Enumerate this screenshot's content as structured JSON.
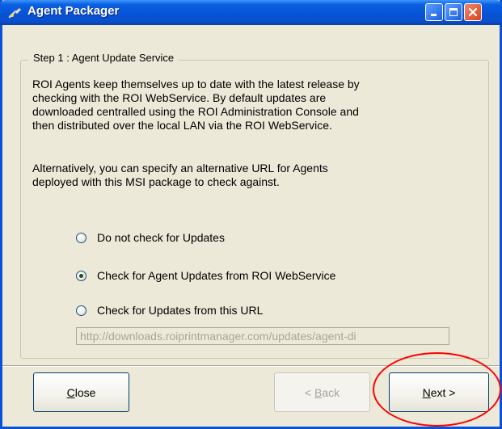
{
  "window": {
    "title": "Agent Packager",
    "controls": {
      "minimize": "minimize",
      "maximize": "maximize",
      "close": "close"
    }
  },
  "step": {
    "label": "Step 1 : Agent Update Service",
    "description1": "ROI Agents keep themselves up to date with the latest release by\nchecking with the ROI WebService. By default updates are\ndownloaded centralled using the ROI Administration Console and\nthen distributed over the local LAN via the ROI WebService.",
    "description2": "Alternatively, you can specify an alternative URL for Agents\ndeployed with this MSI package to check against."
  },
  "options": [
    {
      "label": "Do not check for Updates",
      "checked": false
    },
    {
      "label": "Check for Agent Updates from ROI WebService",
      "checked": true
    },
    {
      "label": "Check for Updates from this URL",
      "checked": false
    }
  ],
  "url_field": {
    "value": "http://downloads.roiprintmanager.com/updates/agent-di",
    "enabled": false
  },
  "buttons": {
    "close": {
      "accel": "C",
      "rest": "lose"
    },
    "back": {
      "prefix": "< ",
      "accel": "B",
      "rest": "ack",
      "enabled": false
    },
    "next": {
      "accel": "N",
      "rest": "ext >"
    }
  },
  "icons": {
    "app": "agent-packager-icon",
    "minimize": "minimize-icon",
    "maximize": "maximize-icon",
    "close": "close-x-icon"
  },
  "colors": {
    "titlebar": "#0654d6",
    "window_bg": "#ece9d8",
    "annotation": "#ff0000",
    "close_button": "#d8421e"
  }
}
